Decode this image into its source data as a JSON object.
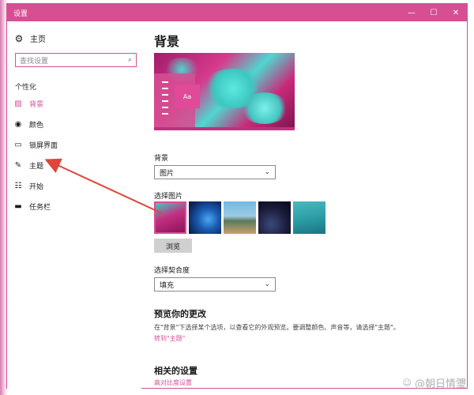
{
  "window": {
    "title": "设置",
    "controls": {
      "minimize": "—",
      "maximize": "☐",
      "close": "✕"
    }
  },
  "sidebar": {
    "home_label": "主页",
    "search_placeholder": "查找设置",
    "section_label": "个性化",
    "items": [
      {
        "label": "背景",
        "icon": "picture-icon",
        "glyph": "▨",
        "active": true
      },
      {
        "label": "颜色",
        "icon": "palette-icon",
        "glyph": "◉",
        "active": false
      },
      {
        "label": "锁屏界面",
        "icon": "lock-screen-icon",
        "glyph": "▭",
        "active": false
      },
      {
        "label": "主题",
        "icon": "theme-icon",
        "glyph": "✎",
        "active": false
      },
      {
        "label": "开始",
        "icon": "start-icon",
        "glyph": "☷",
        "active": false
      },
      {
        "label": "任务栏",
        "icon": "taskbar-icon",
        "glyph": "▬",
        "active": false
      }
    ]
  },
  "main": {
    "page_title": "背景",
    "preview_sample_text": "Aa",
    "background_label": "背景",
    "background_value": "图片",
    "choose_picture_label": "选择图片",
    "browse_label": "浏览",
    "fit_label": "选择契合度",
    "fit_value": "填充",
    "preview_changes_title": "预览你的更改",
    "preview_changes_desc": "在\"背景\"下选择某个选项，以查看它的外观预览。要调整颜色、声音等，请选择\"主题\"。",
    "go_to_themes_link": "转到\"主题\"",
    "related_settings_title": "相关的设置",
    "high_contrast_link": "高对比度设置"
  },
  "watermark": {
    "text": "@朝日情瓕"
  },
  "colors": {
    "accent": "#d64f93",
    "arrow": "#e0453a"
  }
}
